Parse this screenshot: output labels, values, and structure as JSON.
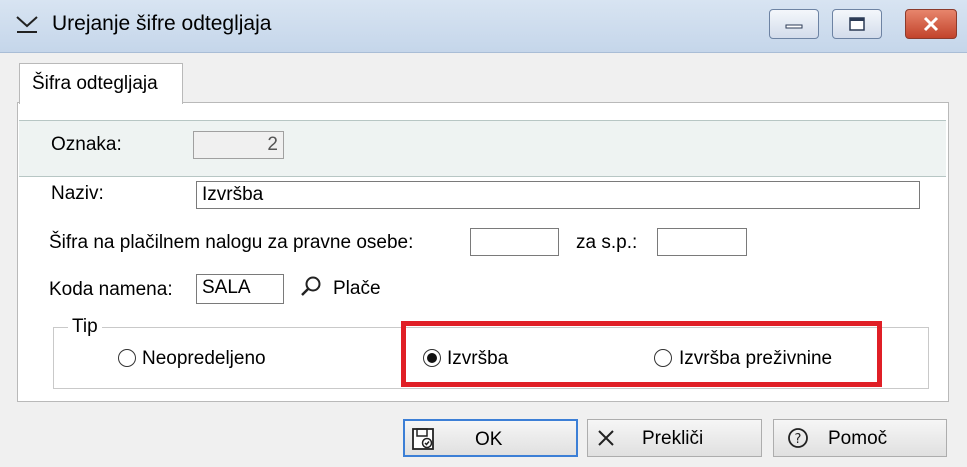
{
  "window": {
    "title": "Urejanje šifre odtegljaja"
  },
  "tab": {
    "label": "Šifra odtegljaja"
  },
  "fields": {
    "oznaka_label": "Oznaka:",
    "oznaka_value": "2",
    "naziv_label": "Naziv:",
    "naziv_value": "Izvršba",
    "sifra_label": "Šifra na plačilnem nalogu za pravne osebe:",
    "sifra_value": "",
    "zasp_label": "za s.p.:",
    "zasp_value": "",
    "koda_label": "Koda namena:",
    "koda_value": "SALA",
    "koda_desc": "Plače"
  },
  "tip": {
    "title": "Tip",
    "options": [
      {
        "label": "Neopredeljeno",
        "checked": false
      },
      {
        "label": "Izvršba",
        "checked": true
      },
      {
        "label": "Izvršba preživnine",
        "checked": false
      }
    ]
  },
  "buttons": {
    "ok": "OK",
    "cancel": "Prekliči",
    "help": "Pomoč"
  },
  "colors": {
    "highlight": "#e01f26",
    "default_button_border": "#3c7fd6"
  },
  "icons": [
    "window-menu-icon",
    "minimize-icon",
    "maximize-icon",
    "close-icon",
    "search-icon",
    "save-icon",
    "cancel-x-icon",
    "help-icon"
  ]
}
